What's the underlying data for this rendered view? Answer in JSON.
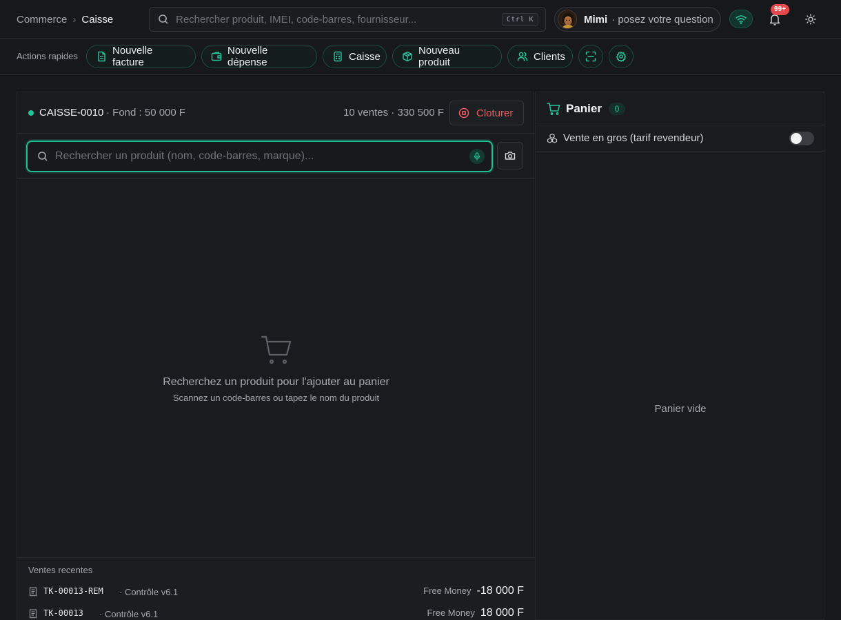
{
  "breadcrumb": {
    "root": "Commerce",
    "separator": "›",
    "current": "Caisse"
  },
  "global_search": {
    "placeholder": "Rechercher produit, IMEI, code-barres, fournisseur...",
    "shortcut": "Ctrl K"
  },
  "assistant": {
    "name": "Mimi",
    "prompt": "· posez votre question"
  },
  "notifications": {
    "count": "99+"
  },
  "quick_actions": {
    "label": "Actions rapides",
    "items": [
      {
        "label": "Nouvelle facture",
        "icon": "file-text-icon"
      },
      {
        "label": "Nouvelle dépense",
        "icon": "wallet-icon"
      },
      {
        "label": "Caisse",
        "icon": "calculator-icon"
      },
      {
        "label": "Nouveau produit",
        "icon": "package-icon"
      },
      {
        "label": "Clients",
        "icon": "users-icon"
      }
    ],
    "icon_buttons": [
      "scan-icon",
      "settings-icon"
    ]
  },
  "session": {
    "id": "CAISSE-0010",
    "fund": "· Fond : 50 000 F",
    "stats": "10 ventes · 330 500 F",
    "close_label": "Cloturer",
    "status_color": "#22c59a"
  },
  "product_search": {
    "placeholder": "Rechercher un produit (nom, code-barres, marque)..."
  },
  "empty_state": {
    "title": "Recherchez un produit pour l'ajouter au panier",
    "subtitle": "Scannez un code-barres ou tapez le nom du produit"
  },
  "recent_sales": {
    "title": "Ventes recentes",
    "rows": [
      {
        "ticket": "TK-00013-REM",
        "description": "· Contrôle v6.1",
        "method": "Free Money",
        "amount": "-18 000 F"
      },
      {
        "ticket": "TK-00013",
        "description": "· Contrôle v6.1",
        "method": "Free Money",
        "amount": "18 000 F"
      }
    ]
  },
  "cart": {
    "title": "Panier",
    "count": "0",
    "wholesale_label": "Vente en gros (tarif revendeur)",
    "wholesale_enabled": false,
    "empty_label": "Panier vide"
  },
  "colors": {
    "accent": "#22c59a",
    "danger": "#ef5b5f",
    "badge": "#e5484d",
    "background": "#17181b"
  }
}
